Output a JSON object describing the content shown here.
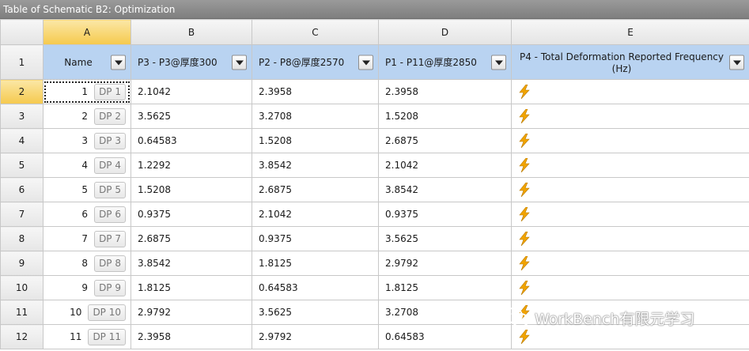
{
  "window": {
    "title": "Table of Schematic B2: Optimization"
  },
  "columns": [
    "A",
    "B",
    "C",
    "D",
    "E"
  ],
  "headers": {
    "row_number": "1",
    "name": "Name",
    "p3": "P3 - P3@厚度300",
    "p2": "P2 - P8@厚度2570",
    "p1": "P1 - P11@厚度2850",
    "p4": "P4 - Total Deformation Reported Frequency (Hz)"
  },
  "rows": [
    {
      "row": "2",
      "index": "1",
      "dp": "DP 1",
      "p3": "2.1042",
      "p2": "2.3958",
      "p1": "2.3958"
    },
    {
      "row": "3",
      "index": "2",
      "dp": "DP 2",
      "p3": "3.5625",
      "p2": "3.2708",
      "p1": "1.5208"
    },
    {
      "row": "4",
      "index": "3",
      "dp": "DP 3",
      "p3": "0.64583",
      "p2": "1.5208",
      "p1": "2.6875"
    },
    {
      "row": "5",
      "index": "4",
      "dp": "DP 4",
      "p3": "1.2292",
      "p2": "3.8542",
      "p1": "2.1042"
    },
    {
      "row": "6",
      "index": "5",
      "dp": "DP 5",
      "p3": "1.5208",
      "p2": "2.6875",
      "p1": "3.8542"
    },
    {
      "row": "7",
      "index": "6",
      "dp": "DP 6",
      "p3": "0.9375",
      "p2": "2.1042",
      "p1": "0.9375"
    },
    {
      "row": "8",
      "index": "7",
      "dp": "DP 7",
      "p3": "2.6875",
      "p2": "0.9375",
      "p1": "3.5625"
    },
    {
      "row": "9",
      "index": "8",
      "dp": "DP 8",
      "p3": "3.8542",
      "p2": "1.8125",
      "p1": "2.9792"
    },
    {
      "row": "10",
      "index": "9",
      "dp": "DP 9",
      "p3": "1.8125",
      "p2": "0.64583",
      "p1": "1.8125"
    },
    {
      "row": "11",
      "index": "10",
      "dp": "DP 10",
      "p3": "2.9792",
      "p2": "3.5625",
      "p1": "3.2708"
    },
    {
      "row": "12",
      "index": "11",
      "dp": "DP 11",
      "p3": "2.3958",
      "p2": "2.9792",
      "p1": "0.64583"
    }
  ],
  "icons": {
    "update_required": "lightning-bolt-icon",
    "dropdown": "chevron-down-icon"
  },
  "colors": {
    "header_bg": "#b9d3f1",
    "selected_bg": "#f5c94d",
    "title_bg": "#8a8a8a",
    "bolt": "#f2a400"
  },
  "watermark": {
    "text": "WorkBench有限元学习"
  }
}
